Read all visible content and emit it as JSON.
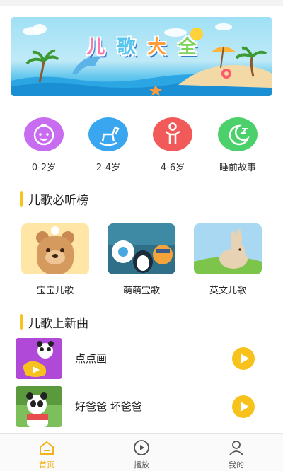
{
  "banner": {
    "title_chars": [
      "儿",
      "歌",
      "大",
      "全"
    ]
  },
  "categories": [
    {
      "label": "0-2岁",
      "icon": "baby-face-icon",
      "color": "#c86cf0"
    },
    {
      "label": "2-4岁",
      "icon": "rocking-horse-icon",
      "color": "#3aa6f0"
    },
    {
      "label": "4-6岁",
      "icon": "child-figure-icon",
      "color": "#f25a5a"
    },
    {
      "label": "睡前故事",
      "icon": "moon-sleep-icon",
      "color": "#4cd06c"
    }
  ],
  "sections": {
    "hot": "儿歌必听榜",
    "new": "儿歌上新曲"
  },
  "hot_list": [
    {
      "label": "宝宝儿歌",
      "image": "bear-cartoon"
    },
    {
      "label": "萌萌宝歌",
      "image": "penguin-cartoon"
    },
    {
      "label": "英文儿歌",
      "image": "rabbit-cartoon"
    }
  ],
  "new_songs": [
    {
      "title": "点点画",
      "image": "panda-cartoon"
    },
    {
      "title": "好爸爸 坏爸爸",
      "image": "panda-cartoon"
    }
  ],
  "tabbar": [
    {
      "label": "首页",
      "icon": "home-icon",
      "active": true
    },
    {
      "label": "播放",
      "icon": "play-circle-icon",
      "active": false
    },
    {
      "label": "我的",
      "icon": "user-icon",
      "active": false
    }
  ],
  "colors": {
    "accent": "#f5c423",
    "tab_active": "#f3b31c"
  }
}
